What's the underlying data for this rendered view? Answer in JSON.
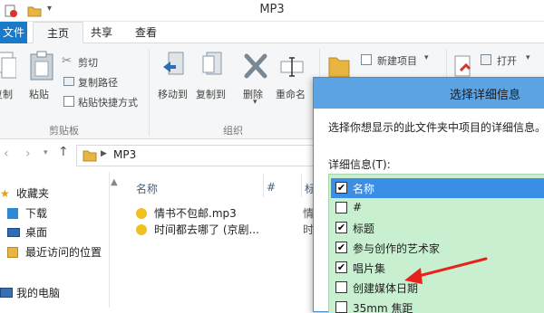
{
  "window": {
    "title": "MP3"
  },
  "tabs": {
    "file": "文件",
    "home": "主页",
    "share": "共享",
    "view": "查看"
  },
  "ribbon": {
    "clipboard": {
      "copy": "复制",
      "paste": "粘贴",
      "cut": "剪切",
      "copy_path": "复制路径",
      "paste_shortcut": "粘贴快捷方式",
      "group": "剪贴板"
    },
    "organize": {
      "move_to": "移动到",
      "copy_to": "复制到",
      "delete": "删除",
      "rename": "重命名",
      "group": "组织"
    },
    "new": {
      "new_item": "新建项目"
    },
    "open": {
      "open": "打开"
    }
  },
  "address": {
    "path": "MP3"
  },
  "nav": {
    "favorites": "收藏夹",
    "downloads": "下载",
    "desktop": "桌面",
    "recent": "最近访问的位置",
    "computer": "我的电脑"
  },
  "filelist": {
    "columns": {
      "name": "名称",
      "number": "#",
      "title": "标"
    },
    "files": [
      {
        "name": "情书不包邮.mp3",
        "tag": "情"
      },
      {
        "name": "时间都去哪了 (京剧...",
        "tag": "时"
      }
    ]
  },
  "dialog": {
    "title": "选择详细信息",
    "description": "选择你想显示的此文件夹中项目的详细信息。",
    "details_label": "详细信息(T):",
    "items": [
      {
        "label": "名称",
        "checked": true,
        "selected": true
      },
      {
        "label": "#",
        "checked": false,
        "selected": false
      },
      {
        "label": "标题",
        "checked": true,
        "selected": false
      },
      {
        "label": "参与创作的艺术家",
        "checked": true,
        "selected": false
      },
      {
        "label": "唱片集",
        "checked": true,
        "selected": false
      },
      {
        "label": "创建媒体日期",
        "checked": false,
        "selected": false
      },
      {
        "label": "35mm 焦距",
        "checked": false,
        "selected": false
      }
    ]
  },
  "colors": {
    "accent": "#1979ca",
    "dialog_title": "#5ba3e2",
    "list_bg": "#c7efd0",
    "arrow": "#e5231a"
  }
}
